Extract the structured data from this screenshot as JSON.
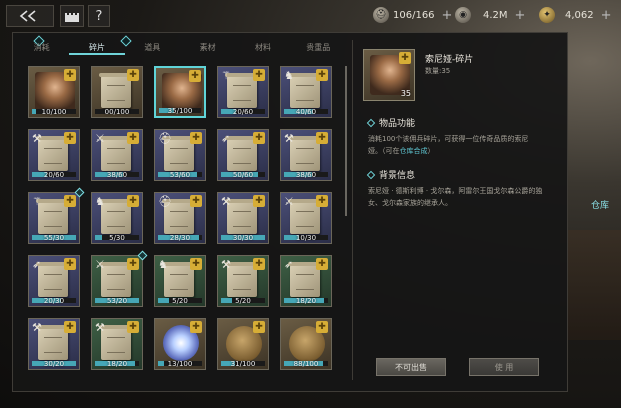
{
  "header": {
    "back_icon": "double-chevron-left-icon",
    "castle_icon": "castle-icon",
    "help_label": "?"
  },
  "resources": [
    {
      "icon": "helmet-icon",
      "value": "106/166"
    },
    {
      "icon": "silver-coin-icon",
      "value": "4.2M"
    },
    {
      "icon": "wheat-icon",
      "value": "4,062"
    }
  ],
  "tabs": [
    "消耗",
    "碎片",
    "道具",
    "素材",
    "材料",
    "贵重品"
  ],
  "active_tab": 1,
  "grid": [
    {
      "kind": "portrait",
      "count": "10/100",
      "progress": 0.1,
      "color": "brown",
      "icon": "helmet-portrait"
    },
    {
      "kind": "scroll",
      "count": "00/100",
      "progress": 0.0,
      "color": "brown"
    },
    {
      "kind": "portrait",
      "count": "35/100",
      "progress": 0.35,
      "color": "brown",
      "selected": true
    },
    {
      "kind": "scroll",
      "count": "20/60",
      "progress": 0.33,
      "color": "blue",
      "icon": "staff-icon"
    },
    {
      "kind": "scroll",
      "count": "40/60",
      "progress": 0.67,
      "color": "blue",
      "icon": "horse-icon"
    },
    {
      "kind": "scroll",
      "count": "20/60",
      "progress": 0.33,
      "color": "blue",
      "icon": "axe-icon"
    },
    {
      "kind": "scroll",
      "count": "38/60",
      "progress": 0.63,
      "color": "blue",
      "icon": "sword-icon"
    },
    {
      "kind": "scroll",
      "count": "53/60",
      "progress": 0.88,
      "color": "blue",
      "icon": "helmet-icon"
    },
    {
      "kind": "scroll",
      "count": "50/60",
      "progress": 0.83,
      "color": "blue",
      "icon": "bow-icon"
    },
    {
      "kind": "scroll",
      "count": "38/60",
      "progress": 0.63,
      "color": "blue",
      "icon": "axe-icon"
    },
    {
      "kind": "scroll",
      "count": "55/30",
      "progress": 1.0,
      "color": "blue",
      "icon": "staff-icon",
      "diamond": true
    },
    {
      "kind": "scroll",
      "count": "5/30",
      "progress": 0.17,
      "color": "blue",
      "icon": "horse-icon"
    },
    {
      "kind": "scroll",
      "count": "28/30",
      "progress": 0.93,
      "color": "blue",
      "icon": "helmet-icon"
    },
    {
      "kind": "scroll",
      "count": "30/30",
      "progress": 1.0,
      "color": "blue",
      "icon": "axe-icon"
    },
    {
      "kind": "scroll",
      "count": "10/30",
      "progress": 0.33,
      "color": "blue",
      "icon": "sword-icon"
    },
    {
      "kind": "scroll",
      "count": "20/30",
      "progress": 0.67,
      "color": "blue",
      "icon": "bow-icon"
    },
    {
      "kind": "scroll",
      "count": "53/20",
      "progress": 1.0,
      "color": "green",
      "icon": "sword-icon",
      "diamond": true
    },
    {
      "kind": "scroll",
      "count": "5/20",
      "progress": 0.25,
      "color": "green",
      "icon": "horse-icon"
    },
    {
      "kind": "scroll",
      "count": "5/20",
      "progress": 0.25,
      "color": "green",
      "icon": "axe-icon"
    },
    {
      "kind": "scroll",
      "count": "18/20",
      "progress": 0.9,
      "color": "green",
      "icon": "bow-icon"
    },
    {
      "kind": "scroll",
      "count": "30/20",
      "progress": 1.0,
      "color": "blue",
      "icon": "axe-icon"
    },
    {
      "kind": "scroll",
      "count": "18/20",
      "progress": 0.9,
      "color": "green",
      "icon": "axe-icon"
    },
    {
      "kind": "orb",
      "count": "13/100",
      "progress": 0.13,
      "color": "brown"
    },
    {
      "kind": "coin",
      "count": "31/100",
      "progress": 0.31,
      "color": "brown"
    },
    {
      "kind": "coin",
      "count": "88/100",
      "progress": 0.88,
      "color": "brown"
    }
  ],
  "detail": {
    "name": "索尼娅-碎片",
    "quantity_label": "数量:35",
    "icon_count": "35",
    "function_title": "物品功能",
    "function_text_1": "消耗100个该佣兵碎片，可获得一位传奇品质的索尼",
    "function_text_2": "娅。（可在",
    "function_link": "仓库合成",
    "function_text_3": "）",
    "background_title": "背景信息",
    "background_text": "索尼娅 · 德斯利博 · 戈尔森，阿雷尔王国戈尔森公爵的独女、戈尔森家族的继承人。",
    "unsellable_button": "不可出售",
    "use_button": "使 用"
  },
  "side": {
    "warehouse_label": "仓库"
  }
}
